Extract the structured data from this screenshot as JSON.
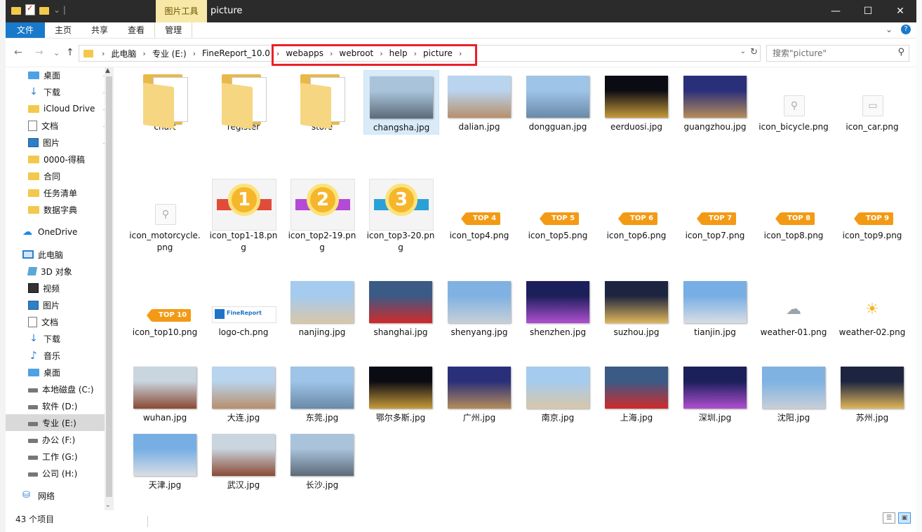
{
  "window": {
    "title": "picture",
    "context_tab": "图片工具",
    "controls": {
      "minimize": "—",
      "maximize": "☐",
      "close": "✕"
    }
  },
  "ribbon": {
    "tabs": [
      "文件",
      "主页",
      "共享",
      "查看",
      "管理"
    ],
    "expand": "⌄",
    "help": "?"
  },
  "nav": {
    "back": "←",
    "forward": "→",
    "down": "⌄",
    "up": "↑"
  },
  "address": {
    "crumbs": [
      "此电脑",
      "专业 (E:)",
      "FineReport_10.0",
      "webapps",
      "webroot",
      "help",
      "picture"
    ],
    "sep": "›",
    "dropdown": "⌄",
    "refresh": "↻"
  },
  "search": {
    "placeholder": "搜索\"picture\"",
    "icon": "⚲"
  },
  "sidebar": {
    "items": [
      {
        "label": "桌面",
        "icon": "desktop-icon",
        "pinned": true
      },
      {
        "label": "下载",
        "icon": "download-icon",
        "pinned": true
      },
      {
        "label": "iCloud Drive",
        "icon": "folder-icon",
        "pinned": true
      },
      {
        "label": "文档",
        "icon": "document-icon",
        "pinned": true
      },
      {
        "label": "图片",
        "icon": "pictures-icon",
        "pinned": true
      },
      {
        "label": "0000-得稿",
        "icon": "folder-icon",
        "pinned": false
      },
      {
        "label": "合同",
        "icon": "folder-icon",
        "pinned": false
      },
      {
        "label": "任务清单",
        "icon": "folder-icon",
        "pinned": false
      },
      {
        "label": "数据字典",
        "icon": "folder-icon",
        "pinned": false
      },
      {
        "label": "OneDrive",
        "icon": "cloud-icon",
        "pinned": false
      },
      {
        "label": "此电脑",
        "icon": "computer-icon",
        "pinned": false
      },
      {
        "label": "3D 对象",
        "icon": "3d-objects-icon",
        "pinned": false
      },
      {
        "label": "视频",
        "icon": "video-icon",
        "pinned": false
      },
      {
        "label": "图片",
        "icon": "pictures-icon",
        "pinned": false
      },
      {
        "label": "文档",
        "icon": "document-icon",
        "pinned": false
      },
      {
        "label": "下载",
        "icon": "download-icon",
        "pinned": false
      },
      {
        "label": "音乐",
        "icon": "music-icon",
        "pinned": false
      },
      {
        "label": "桌面",
        "icon": "desktop-icon",
        "pinned": false
      },
      {
        "label": "本地磁盘 (C:)",
        "icon": "drive-icon",
        "pinned": false
      },
      {
        "label": "软件 (D:)",
        "icon": "drive-icon",
        "pinned": false
      },
      {
        "label": "专业 (E:)",
        "icon": "drive-icon",
        "pinned": false
      },
      {
        "label": "办公 (F:)",
        "icon": "drive-icon",
        "pinned": false
      },
      {
        "label": "工作 (G:)",
        "icon": "drive-icon",
        "pinned": false
      },
      {
        "label": "公司 (H:)",
        "icon": "drive-icon",
        "pinned": false
      },
      {
        "label": "网络",
        "icon": "network-icon",
        "pinned": false
      }
    ],
    "pin_glyph": "📌",
    "scroll_up": "▲",
    "scroll_down": "⌄"
  },
  "files": [
    {
      "name": "chart",
      "kind": "folder"
    },
    {
      "name": "register",
      "kind": "folder"
    },
    {
      "name": "store",
      "kind": "folder"
    },
    {
      "name": "changsha.jpg",
      "kind": "photo",
      "c1": "#a9c3db",
      "c2": "#5c6a78"
    },
    {
      "name": "dalian.jpg",
      "kind": "photo",
      "c1": "#b9d4ee",
      "c2": "#b88f6b"
    },
    {
      "name": "dongguan.jpg",
      "kind": "photo",
      "c1": "#9ec4e8",
      "c2": "#6a8aa8"
    },
    {
      "name": "eerduosi.jpg",
      "kind": "photo",
      "c1": "#0b0b14",
      "c2": "#c79b3a"
    },
    {
      "name": "guangzhou.jpg",
      "kind": "photo",
      "c1": "#2a2f7a",
      "c2": "#b68c5a"
    },
    {
      "name": "icon_bicycle.png",
      "kind": "small",
      "glyph": "⚲"
    },
    {
      "name": "icon_car.png",
      "kind": "small",
      "glyph": "▭"
    },
    {
      "name": "icon_motorcycle.png",
      "kind": "small",
      "glyph": "⚲"
    },
    {
      "name": "icon_top1-18.png",
      "kind": "medal",
      "num": "1",
      "band": "#e04b3a"
    },
    {
      "name": "icon_top2-19.png",
      "kind": "medal",
      "num": "2",
      "band": "#b44ad6"
    },
    {
      "name": "icon_top3-20.png",
      "kind": "medal",
      "num": "3",
      "band": "#2aa0d8"
    },
    {
      "name": "icon_top4.png",
      "kind": "tag",
      "text": "TOP 4"
    },
    {
      "name": "icon_top5.png",
      "kind": "tag",
      "text": "TOP 5"
    },
    {
      "name": "icon_top6.png",
      "kind": "tag",
      "text": "TOP 6"
    },
    {
      "name": "icon_top7.png",
      "kind": "tag",
      "text": "TOP 7"
    },
    {
      "name": "icon_top8.png",
      "kind": "tag",
      "text": "TOP 8"
    },
    {
      "name": "icon_top9.png",
      "kind": "tag",
      "text": "TOP 9"
    },
    {
      "name": "icon_top10.png",
      "kind": "tag",
      "text": "TOP 10"
    },
    {
      "name": "logo-ch.png",
      "kind": "logo",
      "logo_text": "FineReport"
    },
    {
      "name": "nanjing.jpg",
      "kind": "photo",
      "c1": "#a5cbee",
      "c2": "#d9c7a8"
    },
    {
      "name": "shanghai.jpg",
      "kind": "photo",
      "c1": "#3b5a86",
      "c2": "#d12a2a"
    },
    {
      "name": "shenyang.jpg",
      "kind": "photo",
      "c1": "#7fb2e2",
      "c2": "#c7cfd8"
    },
    {
      "name": "shenzhen.jpg",
      "kind": "photo",
      "c1": "#1b1f5a",
      "c2": "#b04fd0"
    },
    {
      "name": "suzhou.jpg",
      "kind": "photo",
      "c1": "#1c2440",
      "c2": "#e0b65a"
    },
    {
      "name": "tianjin.jpg",
      "kind": "photo",
      "c1": "#77aee4",
      "c2": "#d8dde4"
    },
    {
      "name": "weather-01.png",
      "kind": "weather",
      "glyph": "☁",
      "color": "#9aa4ad"
    },
    {
      "name": "weather-02.png",
      "kind": "weather",
      "glyph": "☀",
      "color": "#f4b321"
    },
    {
      "name": "wuhan.jpg",
      "kind": "photo",
      "c1": "#c9d5df",
      "c2": "#8a4a34"
    },
    {
      "name": "大连.jpg",
      "kind": "photo",
      "c1": "#b9d4ee",
      "c2": "#b88f6b"
    },
    {
      "name": "东莞.jpg",
      "kind": "photo",
      "c1": "#9ec4e8",
      "c2": "#6a8aa8"
    },
    {
      "name": "鄂尔多斯.jpg",
      "kind": "photo",
      "c1": "#0b0b14",
      "c2": "#c79b3a"
    },
    {
      "name": "广州.jpg",
      "kind": "photo",
      "c1": "#2a2f7a",
      "c2": "#b68c5a"
    },
    {
      "name": "南京.jpg",
      "kind": "photo",
      "c1": "#a5cbee",
      "c2": "#d9c7a8"
    },
    {
      "name": "上海.jpg",
      "kind": "photo",
      "c1": "#3b5a86",
      "c2": "#d12a2a"
    },
    {
      "name": "深圳.jpg",
      "kind": "photo",
      "c1": "#1b1f5a",
      "c2": "#b04fd0"
    },
    {
      "name": "沈阳.jpg",
      "kind": "photo",
      "c1": "#7fb2e2",
      "c2": "#c7cfd8"
    },
    {
      "name": "苏州.jpg",
      "kind": "photo",
      "c1": "#1c2440",
      "c2": "#e0b65a"
    },
    {
      "name": "天津.jpg",
      "kind": "photo",
      "c1": "#77aee4",
      "c2": "#d8dde4"
    },
    {
      "name": "武汉.jpg",
      "kind": "photo",
      "c1": "#c9d5df",
      "c2": "#8a4a34"
    },
    {
      "name": "长沙.jpg",
      "kind": "photo",
      "c1": "#a9c3db",
      "c2": "#5c6a78"
    }
  ],
  "selected_file": "changsha.jpg",
  "status": {
    "count": "43 个项目",
    "view_details": "☰",
    "view_icons": "▣"
  },
  "colors": {
    "accent": "#1979ca",
    "highlight_box": "#e8202a",
    "context_tab": "#f7e8a7"
  }
}
